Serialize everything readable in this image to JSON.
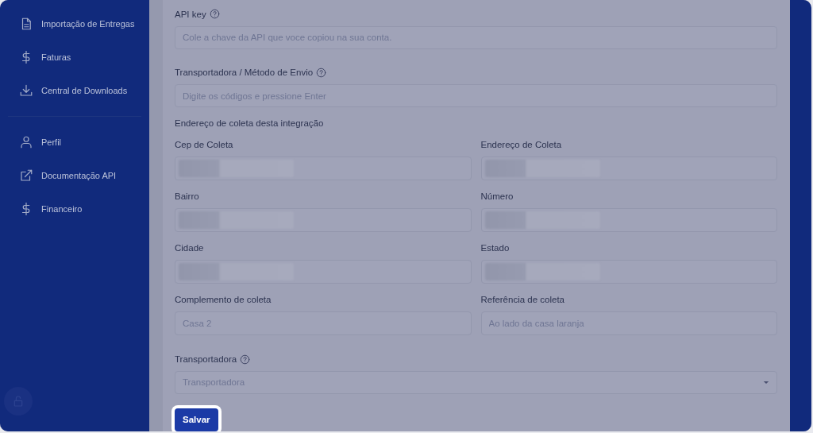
{
  "sidebar": {
    "sections": [
      {
        "items": [
          {
            "label": "Importação de Entregas",
            "kind": "document"
          },
          {
            "label": "Faturas",
            "kind": "dollar"
          },
          {
            "label": "Central de Downloads",
            "kind": "download"
          }
        ]
      },
      {
        "items": [
          {
            "label": "Perfil",
            "kind": "user"
          },
          {
            "label": "Documentação API",
            "kind": "external-link"
          },
          {
            "label": "Financeiro",
            "kind": "dollar"
          }
        ]
      }
    ]
  },
  "form": {
    "api_key": {
      "label": "API key",
      "help": true,
      "placeholder": "Cole a chave da API que voce copiou na sua conta."
    },
    "shipping_method": {
      "label": "Transportadora / Método de Envio",
      "help": true,
      "placeholder": "Digite os códigos e pressione Enter"
    },
    "pickup_heading": "Endereço de coleta desta integração",
    "pickup_fields": [
      {
        "label": "Cep de Coleta",
        "redacted": true
      },
      {
        "label": "Endereço de Coleta",
        "redacted": true
      },
      {
        "label": "Bairro",
        "redacted": true
      },
      {
        "label": "Número",
        "redacted": true
      },
      {
        "label": "Cidade",
        "redacted": true
      },
      {
        "label": "Estado",
        "redacted": true
      },
      {
        "label": "Complemento de coleta",
        "redacted": false,
        "placeholder": "Casa 2"
      },
      {
        "label": "Referência de coleta",
        "redacted": false,
        "placeholder": "Ao lado da casa laranja"
      }
    ],
    "carrier": {
      "label": "Transportadora",
      "help": true,
      "placeholder": "Transportadora"
    },
    "save_button": {
      "label": "Salvar",
      "highlighted": true
    }
  }
}
